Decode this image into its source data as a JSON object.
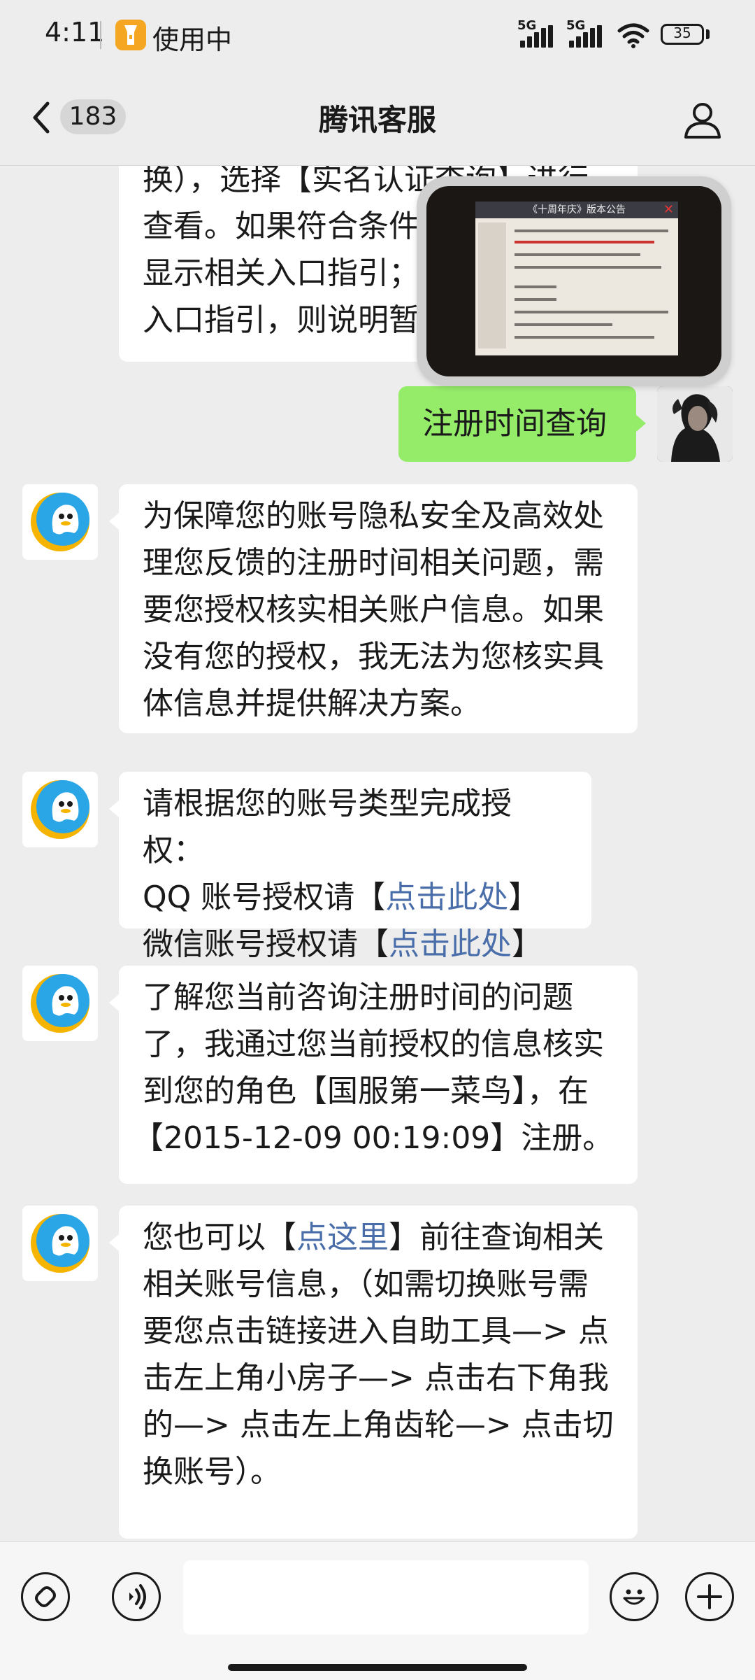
{
  "status_bar": {
    "time": "4:11",
    "using_label": "使用中",
    "signal_label_1": "5G",
    "signal_label_2": "5G",
    "battery": "35"
  },
  "header": {
    "unread_count": "183",
    "title": "腾讯客服"
  },
  "messages": [
    {
      "id": "m0",
      "side": "left",
      "lines": [
        "换），选择【实名认证查询】进行",
        "查看。如果符合条件",
        "显示相关入口指引；",
        "入口指引，则说明暂"
      ]
    },
    {
      "id": "m1",
      "side": "right",
      "text": "注册时间查询"
    },
    {
      "id": "m2",
      "side": "left",
      "lines": [
        "为保障您的账号隐私安全及高效处",
        "理您反馈的注册时间相关问题，需",
        "要您授权核实相关账户信息。如果",
        "没有您的授权，我无法为您核实具",
        "体信息并提供解决方案。"
      ]
    },
    {
      "id": "m3",
      "side": "left",
      "line1": "请根据您的账号类型完成授权：",
      "line2_prefix": "QQ 账号授权请【",
      "line2_link": "点击此处",
      "line2_suffix": "】",
      "line3_prefix": "微信账号授权请【",
      "line3_link": "点击此处",
      "line3_suffix": "】"
    },
    {
      "id": "m4",
      "side": "left",
      "lines": [
        "了解您当前咨询注册时间的问题",
        "了，我通过您当前授权的信息核实",
        "到您的角色【国服第一菜鸟】，在",
        "【2015-12-09 00:19:09】注册。"
      ]
    },
    {
      "id": "m5",
      "side": "left",
      "line1_prefix": "您也可以【",
      "line1_link": "点这里",
      "line1_suffix": "】前往查询相关",
      "lines": [
        "相关账号信息，（如需切换账号需",
        "要您点击链接进入自助工具—> 点",
        "击左上角小房子—> 点击右下角我",
        "的—> 点击左上角齿轮—> 点击切",
        "换账号）。"
      ]
    }
  ],
  "floating_window": {
    "header_text": "《十周年庆》版本公告"
  },
  "input": {
    "value": "",
    "placeholder": ""
  },
  "colors": {
    "background": "#ededed",
    "self_bubble": "#95ec69",
    "link": "#4a6ea9",
    "badge": "#f5a623"
  },
  "icons": [
    "flashlight-icon",
    "signal-icon",
    "wifi-icon",
    "battery-icon",
    "back-icon",
    "profile-icon",
    "bot-avatar-icon",
    "mini-program-icon",
    "voice-icon",
    "emoji-icon",
    "plus-icon"
  ]
}
